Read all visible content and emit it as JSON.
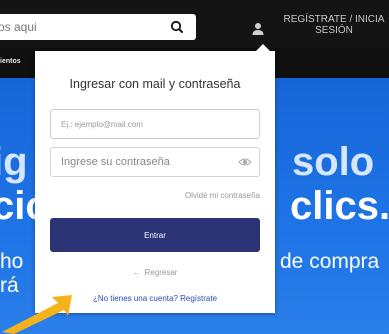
{
  "header": {
    "search_placeholder": "os aqui",
    "register_label_line1": "REGÍSTRATE / INICIA",
    "register_label_line2": "SESIÓN",
    "icons": {
      "search": "search-icon",
      "user": "user-icon"
    }
  },
  "nav": {
    "partial_text": "ientos"
  },
  "hero": {
    "line1_left": "ig",
    "line1_right": "solo",
    "line2_left": "ció",
    "line2_right": "clics.",
    "line3_left": "ho",
    "line3_right": "de compra",
    "line4_left": "rá"
  },
  "login_modal": {
    "title": "Ingresar con mail y contraseña",
    "email_placeholder": "Ej.: ejemplo@mail.com",
    "password_placeholder": "Ingrese su contraseña",
    "forgot_password": "Olvidé mi contraseña",
    "submit_label": "Entrar",
    "back_label": "Regresar",
    "signup_prompt": "¿No tienes una cuenta? Regístrate",
    "icons": {
      "show_password": "eye-icon",
      "back": "arrow-left-icon"
    }
  },
  "overlay": {
    "pointer_arrow": "arrow-pointer-icon",
    "pointer_color": "#f5b21c"
  },
  "colors": {
    "topbar": "#141414",
    "hero_blue": "#1d6fe0",
    "button": "#2b3375",
    "link": "#2b47b8"
  }
}
